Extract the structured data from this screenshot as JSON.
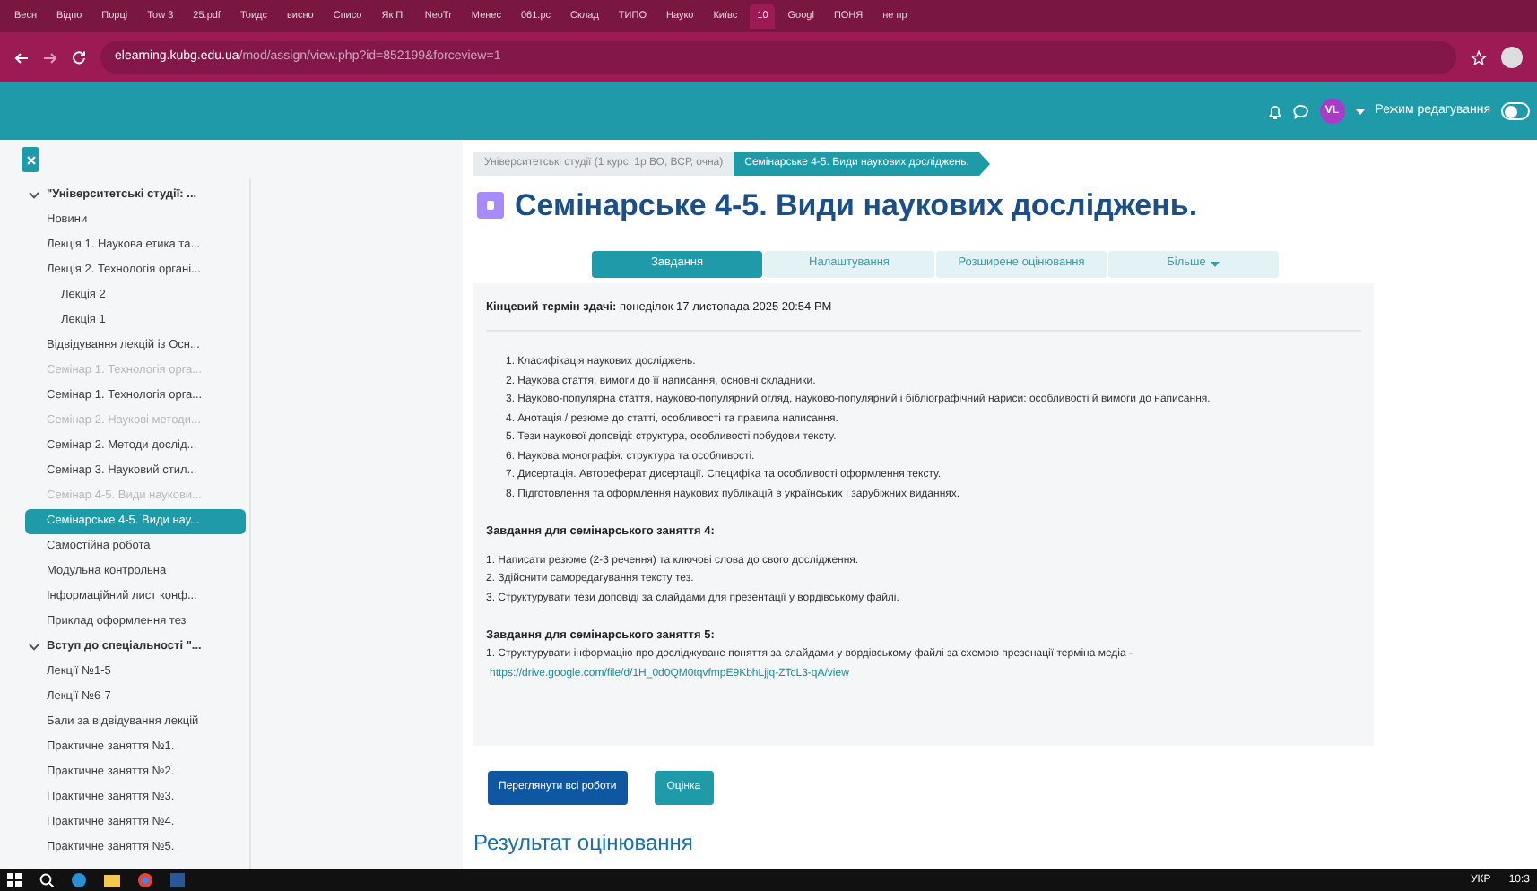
{
  "browser": {
    "tabs": [
      {
        "label": "Весн",
        "selected": false
      },
      {
        "label": "Відпо",
        "selected": false
      },
      {
        "label": "Порці",
        "selected": false
      },
      {
        "label": "Тоw 3",
        "selected": false
      },
      {
        "label": "25.pdf",
        "selected": false
      },
      {
        "label": "Тоидс",
        "selected": false
      },
      {
        "label": "висно",
        "selected": false
      },
      {
        "label": "Списо",
        "selected": false
      },
      {
        "label": "Як Пі",
        "selected": false
      },
      {
        "label": "NeoTr",
        "selected": false
      },
      {
        "label": "Менес",
        "selected": false
      },
      {
        "label": "061.pc",
        "selected": false
      },
      {
        "label": "Склад",
        "selected": false
      },
      {
        "label": "ТИПО",
        "selected": false
      },
      {
        "label": "Науко",
        "selected": false
      },
      {
        "label": "Київс",
        "selected": false
      },
      {
        "label": "10",
        "selected": true
      },
      {
        "label": "Googl",
        "selected": false
      },
      {
        "label": "ПОНЯ",
        "selected": false
      },
      {
        "label": "не пр",
        "selected": false
      }
    ],
    "url_host": "elearning.kubg.edu.ua",
    "url_path": "/mod/assign/view.php?id=852199&forceview=1"
  },
  "header": {
    "avatar": "VL",
    "edit_mode_label": "Режим редагування",
    "edit_mode_on": false
  },
  "sidebar": {
    "items": [
      {
        "kind": "section",
        "label": "\"Університетські студії: ...",
        "expanded": true
      },
      {
        "kind": "item",
        "label": "Новини",
        "dimmed": false,
        "selected": false
      },
      {
        "kind": "item",
        "label": "Лекція 1. Наукова етика та...",
        "dimmed": false,
        "selected": false
      },
      {
        "kind": "item",
        "label": "Лекція 2. Технологія органі...",
        "dimmed": false,
        "selected": false
      },
      {
        "kind": "subitem",
        "label": "Лекція 2",
        "dimmed": false,
        "selected": false
      },
      {
        "kind": "subitem",
        "label": "Лекція 1",
        "dimmed": false,
        "selected": false
      },
      {
        "kind": "item",
        "label": "Відвідування лекцій із Осн...",
        "dimmed": false,
        "selected": false
      },
      {
        "kind": "item",
        "label": "Семінар 1. Технологія орга...",
        "dimmed": true,
        "selected": false
      },
      {
        "kind": "item",
        "label": "Семінар 1. Технологія орга...",
        "dimmed": false,
        "selected": false
      },
      {
        "kind": "item",
        "label": "Семінар 2. Наукові методи...",
        "dimmed": true,
        "selected": false
      },
      {
        "kind": "item",
        "label": "Семінар 2. Методи дослід...",
        "dimmed": false,
        "selected": false
      },
      {
        "kind": "item",
        "label": "Семінар 3. Науковий стил...",
        "dimmed": false,
        "selected": false
      },
      {
        "kind": "item",
        "label": "Семінар 4-5. Види наукови...",
        "dimmed": true,
        "selected": false
      },
      {
        "kind": "item",
        "label": "Семінарське 4-5. Види нау...",
        "dimmed": false,
        "selected": true
      },
      {
        "kind": "item",
        "label": "Самостійна робота",
        "dimmed": false,
        "selected": false
      },
      {
        "kind": "item",
        "label": "Модульна контрольна",
        "dimmed": false,
        "selected": false
      },
      {
        "kind": "item",
        "label": "Інформаційний лист конф...",
        "dimmed": false,
        "selected": false
      },
      {
        "kind": "item",
        "label": "Приклад оформлення тез",
        "dimmed": false,
        "selected": false
      },
      {
        "kind": "section",
        "label": "Вступ до спеціальності \"...",
        "expanded": true
      },
      {
        "kind": "item",
        "label": "Лекції №1-5",
        "dimmed": false,
        "selected": false
      },
      {
        "kind": "item",
        "label": "Лекції №6-7",
        "dimmed": false,
        "selected": false
      },
      {
        "kind": "item",
        "label": "Бали за відвідування лекцій",
        "dimmed": false,
        "selected": false
      },
      {
        "kind": "item",
        "label": "Практичне заняття №1.",
        "dimmed": false,
        "selected": false
      },
      {
        "kind": "item",
        "label": "Практичне заняття №2.",
        "dimmed": false,
        "selected": false
      },
      {
        "kind": "item",
        "label": "Практичне заняття №3.",
        "dimmed": false,
        "selected": false
      },
      {
        "kind": "item",
        "label": "Практичне заняття №4.",
        "dimmed": false,
        "selected": false
      },
      {
        "kind": "item",
        "label": "Практичне заняття №5.",
        "dimmed": false,
        "selected": false
      }
    ]
  },
  "breadcrumb": [
    "Університетські студії (1 курс, 1р ВО, ВСР, очна)",
    "Семінарське 4-5. Види наукових досліджень."
  ],
  "title": "Семінарське 4-5. Види наукових досліджень.",
  "tabs": [
    {
      "label": "Завдання",
      "selected": true,
      "dropdown": false
    },
    {
      "label": "Налаштування",
      "selected": false,
      "dropdown": false
    },
    {
      "label": "Розширене оцінювання",
      "selected": false,
      "dropdown": false
    },
    {
      "label": "Більше",
      "selected": false,
      "dropdown": true
    }
  ],
  "due": "**Кінцевий термін здачі:** понеділок 17 листопада 2025 20:54 PM",
  "topics": [
    "1. Класифікація наукових досліджень.",
    "2. Наукова стаття, вимоги до її написання, основні складники.",
    "3. Науково-популярна стаття, науково-популярний огляд, науково-популярний і бібліографічний нариси: особливості й вимоги до написання.",
    "4. Анотація / резюме до статті, особливості та правила написання.",
    "5. Тези наукової доповіді: структура, особливості побудови тексту.",
    "6. Наукова монографія: структура та особливості.",
    "7. Дисертація. Автореферат дисертації. Специфіка та особливості оформлення тексту.",
    "8. Підготовлення та оформлення наукових публікацій в українських і зарубіжних виданнях."
  ],
  "tasks": [
    {
      "heading": "Завдання для семінарського заняття 4:",
      "lines": [
        "1. Написати резюме (2-3 речення) та ключові слова до свого дослідження.",
        "2. Здійснити саморедагування тексту тез.",
        "3. Структурувати тези доповіді за слайдами для презентації у вордівському файлі."
      ]
    },
    {
      "heading": "Завдання для семінарського заняття 5:",
      "lines": [
        "1. Структурувати інформацію про досліджуване поняття за слайдами у вордівському файлі за схемою презенації термінa медіа -"
      ],
      "link": "https://drive.google.com/file/d/1H_0d0QM0tqvfmpE9KbhLjjq-ZTcL3-qA/view"
    }
  ],
  "buttons": [
    {
      "label": "Переглянути всі роботи",
      "kind": "primary"
    },
    {
      "label": "Оцінка",
      "kind": "secondary"
    }
  ],
  "result_heading": "Результат оцінювання",
  "taskbar": {
    "language": "УКР",
    "time": "10:3"
  }
}
